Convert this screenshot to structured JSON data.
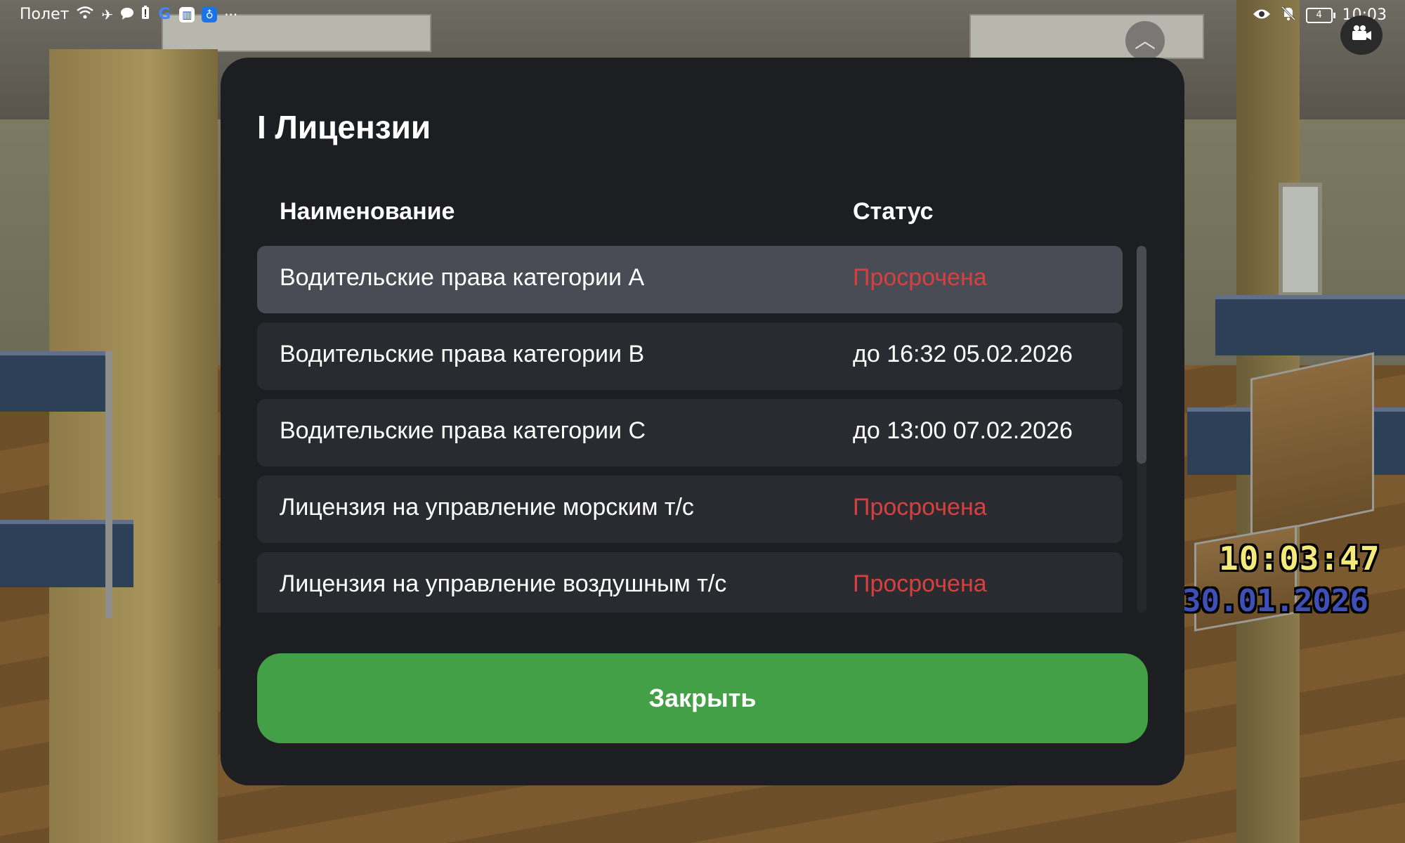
{
  "status_bar": {
    "carrier": "Полет",
    "battery": "4",
    "time": "10:03"
  },
  "modal": {
    "title": "I Лицензии",
    "columns": {
      "name": "Наименование",
      "status": "Статус"
    },
    "rows": [
      {
        "name": "Водительские права категории A",
        "status": "Просрочена",
        "state": "expired"
      },
      {
        "name": "Водительские права категории B",
        "status": "до 16:32 05.02.2026",
        "state": "valid"
      },
      {
        "name": "Водительские права категории C",
        "status": "до 13:00 07.02.2026",
        "state": "valid"
      },
      {
        "name": "Лицензия на управление морским т/с",
        "status": "Просрочена",
        "state": "expired"
      },
      {
        "name": "Лицензия на управление воздушным т/с",
        "status": "Просрочена",
        "state": "expired"
      }
    ],
    "close_label": "Закрыть"
  },
  "hud": {
    "time": "10:03:47",
    "date": "30.01.2026"
  },
  "colors": {
    "expired": "#d6403f",
    "valid": "#ffffff",
    "accent_button": "#43a047",
    "modal_bg": "#1d1e22"
  }
}
